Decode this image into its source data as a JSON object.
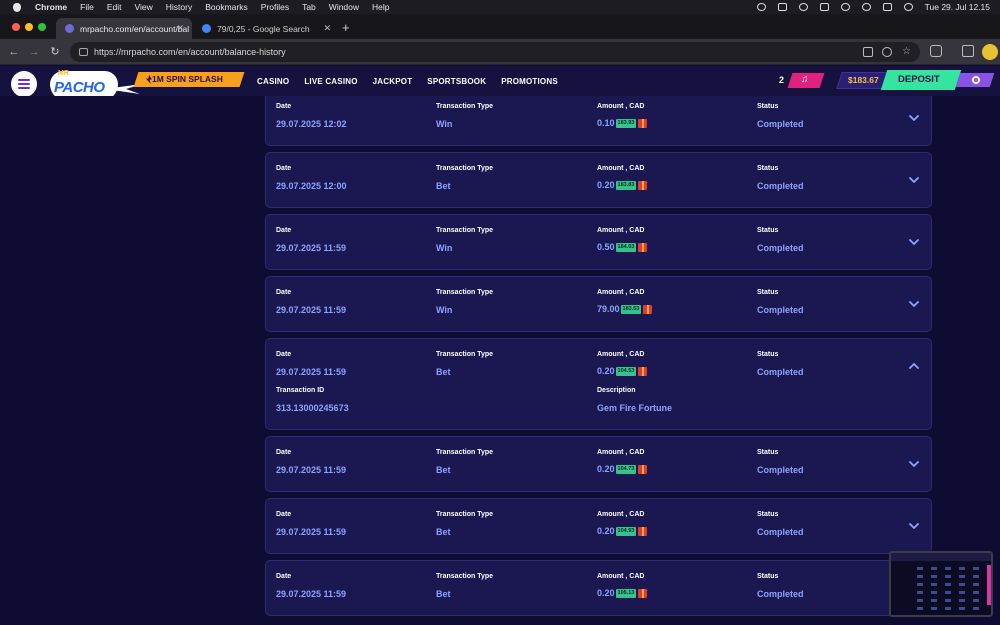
{
  "os_menubar": {
    "app_name": "Chrome",
    "items": [
      "File",
      "Edit",
      "View",
      "History",
      "Bookmarks",
      "Profiles",
      "Tab",
      "Window",
      "Help"
    ],
    "clock": "Tue 29. Jul  12.15"
  },
  "browser": {
    "tabs": [
      {
        "title": "mrpacho.com/en/account/bal",
        "favicon_color": "#6b6bd6",
        "active": true
      },
      {
        "title": "79/0,25 - Google Search",
        "favicon_color": "#4285f4",
        "active": false
      }
    ],
    "new_tab_symbol": "+",
    "url": "https://mrpacho.com/en/account/balance-history"
  },
  "site": {
    "logo_mr": "MR",
    "logo_text": "PACHO",
    "promo_label": "1M SPIN SPLASH",
    "nav": [
      "CASINO",
      "LIVE CASINO",
      "JACKPOT",
      "SPORTSBOOK",
      "PROMOTIONS"
    ],
    "notification_count": "2",
    "music_icon": "♫",
    "balance": "$183.67",
    "deposit_label": "DEPOSIT"
  },
  "labels": {
    "date": "Date",
    "type": "Transaction Type",
    "amount": "Amount , CAD",
    "status": "Status",
    "transaction_id": "Transaction ID",
    "description": "Description"
  },
  "transactions": [
    {
      "date": "29.07.2025 12:02",
      "type": "Win",
      "amount": "0.10",
      "balance_chip": "183.93",
      "status": "Completed",
      "expanded": false
    },
    {
      "date": "29.07.2025 12:00",
      "type": "Bet",
      "amount": "0.20",
      "balance_chip": "183.83",
      "status": "Completed",
      "expanded": false
    },
    {
      "date": "29.07.2025 11:59",
      "type": "Win",
      "amount": "0.50",
      "balance_chip": "184.03",
      "status": "Completed",
      "expanded": false
    },
    {
      "date": "29.07.2025 11:59",
      "type": "Win",
      "amount": "79.00",
      "balance_chip": "183.53",
      "status": "Completed",
      "expanded": false
    },
    {
      "date": "29.07.2025 11:59",
      "type": "Bet",
      "amount": "0.20",
      "balance_chip": "104.53",
      "status": "Completed",
      "expanded": true,
      "transaction_id": "313.13000245673",
      "description": "Gem Fire Fortune"
    },
    {
      "date": "29.07.2025 11:59",
      "type": "Bet",
      "amount": "0.20",
      "balance_chip": "104.73",
      "status": "Completed",
      "expanded": false
    },
    {
      "date": "29.07.2025 11:59",
      "type": "Bet",
      "amount": "0.20",
      "balance_chip": "104.93",
      "status": "Completed",
      "expanded": false
    },
    {
      "date": "29.07.2025 11:59",
      "type": "Bet",
      "amount": "0.20",
      "balance_chip": "105.13",
      "status": "Completed",
      "expanded": false
    }
  ],
  "colors": {
    "accent_value": "#8da4ff",
    "deposit": "#35e59f",
    "promo": "#f7a01d",
    "balance_text": "#f4c23a"
  }
}
